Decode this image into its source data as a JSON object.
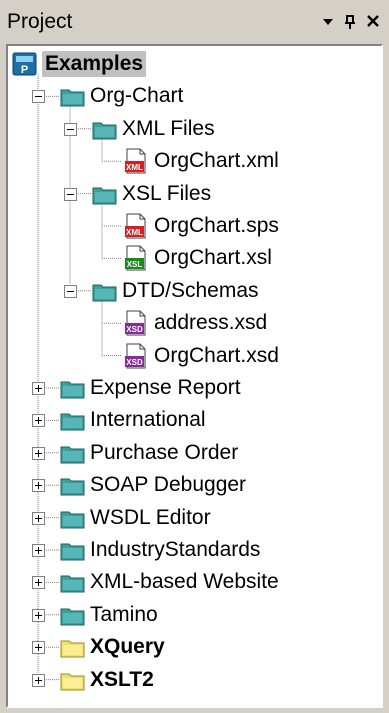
{
  "panel": {
    "title": "Project",
    "buttons": [
      {
        "name": "dropdown-arrow-icon",
        "glyph": "▾"
      },
      {
        "name": "pin-icon",
        "glyph": "ᵖ"
      },
      {
        "name": "close-icon",
        "glyph": "✕"
      }
    ]
  },
  "tree": {
    "root": {
      "label": "Examples",
      "icon": "project-icon"
    },
    "org_chart": {
      "label": "Org-Chart",
      "xml_files": {
        "label": "XML Files",
        "files": [
          {
            "label": "OrgChart.xml",
            "icon": "xml-file-icon"
          }
        ]
      },
      "xsl_files": {
        "label": "XSL Files",
        "files": [
          {
            "label": "OrgChart.sps",
            "icon": "xml-file-icon"
          },
          {
            "label": "OrgChart.xsl",
            "icon": "xsl-file-icon"
          }
        ]
      },
      "dtd_schemas": {
        "label": "DTD/Schemas",
        "files": [
          {
            "label": "address.xsd",
            "icon": "xsd-file-icon"
          },
          {
            "label": "OrgChart.xsd",
            "icon": "xsd-file-icon"
          }
        ]
      }
    },
    "folders": [
      {
        "label": "Expense Report",
        "bold": false,
        "color": "teal"
      },
      {
        "label": "International",
        "bold": false,
        "color": "teal"
      },
      {
        "label": "Purchase Order",
        "bold": false,
        "color": "teal"
      },
      {
        "label": "SOAP Debugger",
        "bold": false,
        "color": "teal"
      },
      {
        "label": "WSDL Editor",
        "bold": false,
        "color": "teal"
      },
      {
        "label": "IndustryStandards",
        "bold": false,
        "color": "teal"
      },
      {
        "label": "XML-based Website",
        "bold": false,
        "color": "teal"
      },
      {
        "label": "Tamino",
        "bold": false,
        "color": "teal"
      },
      {
        "label": "XQuery",
        "bold": true,
        "color": "yellow"
      },
      {
        "label": "XSLT2",
        "bold": true,
        "color": "yellow"
      }
    ],
    "badges": {
      "xml": "XML",
      "xsl": "XSL",
      "xsd": "XSD",
      "project": "P"
    }
  },
  "colors": {
    "teal_folder": "#3aa0a0",
    "yellow_folder": "#f4e06c",
    "xml_badge": "#d42020",
    "xsl_badge": "#1a8a1a",
    "xsd_badge": "#8a2a9a"
  }
}
